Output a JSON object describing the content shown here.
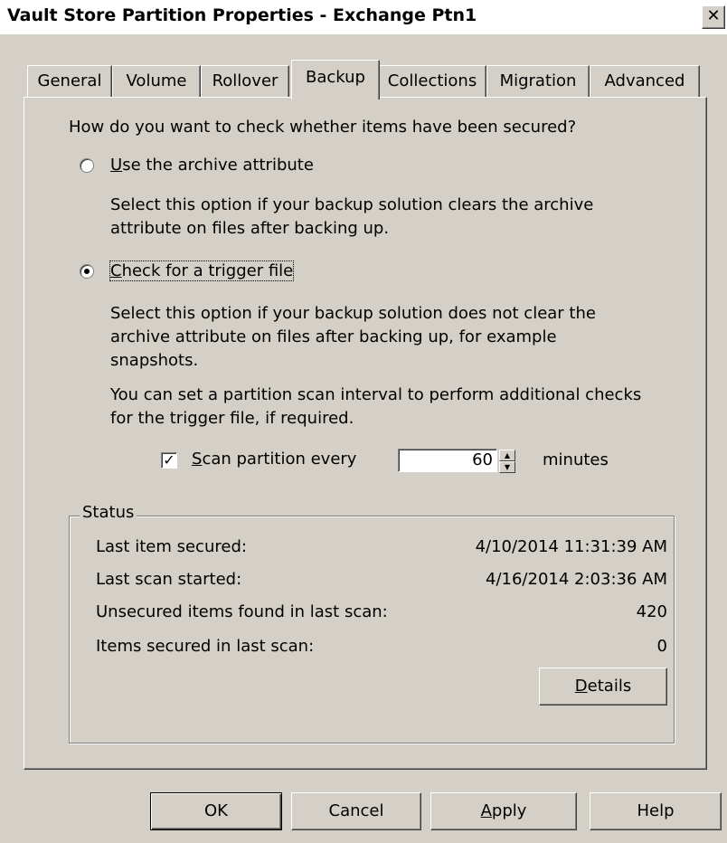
{
  "window": {
    "title": "Vault Store Partition Properties - Exchange Ptn1",
    "close_glyph": "✕"
  },
  "tabs": [
    {
      "label": "General",
      "active": false
    },
    {
      "label": "Volume",
      "active": false
    },
    {
      "label": "Rollover",
      "active": false
    },
    {
      "label": "Backup",
      "active": true
    },
    {
      "label": "Collections",
      "active": false
    },
    {
      "label": "Migration",
      "active": false
    },
    {
      "label": "Advanced",
      "active": false
    }
  ],
  "backup": {
    "question": "How do you want to check whether items have been secured?",
    "option_archive": {
      "label_accel": "U",
      "label_rest": "se the archive attribute",
      "selected": false,
      "desc_line1": "Select this option if your backup solution clears the archive",
      "desc_line2": "attribute on files after backing up."
    },
    "option_trigger": {
      "label_accel": "C",
      "label_rest": "heck for a trigger file",
      "selected": true,
      "desc_line1": "Select this option if your backup solution does not clear the",
      "desc_line2": "archive attribute on files after backing up, for example",
      "desc_line3": "snapshots.",
      "scan_line1": "You can set a partition scan interval to perform additional checks",
      "scan_line2": "for the trigger file, if required."
    },
    "scan": {
      "checked": true,
      "check_glyph": "✓",
      "label_accel": "S",
      "label_rest": "can partition every",
      "value": "60",
      "unit": "minutes"
    }
  },
  "status": {
    "legend": "Status",
    "rows": [
      {
        "label": "Last item secured:",
        "value": "4/10/2014 11:31:39 AM"
      },
      {
        "label": "Last scan started:",
        "value": "4/16/2014 2:03:36 AM"
      },
      {
        "label": "Unsecured items found in last scan:",
        "value": "420"
      },
      {
        "label": "Items secured in last scan:",
        "value": "0"
      }
    ],
    "details_accel": "D",
    "details_rest": "etails"
  },
  "footer": {
    "ok": "OK",
    "cancel": "Cancel",
    "apply_accel": "A",
    "apply_rest": "pply",
    "help": "Help"
  }
}
